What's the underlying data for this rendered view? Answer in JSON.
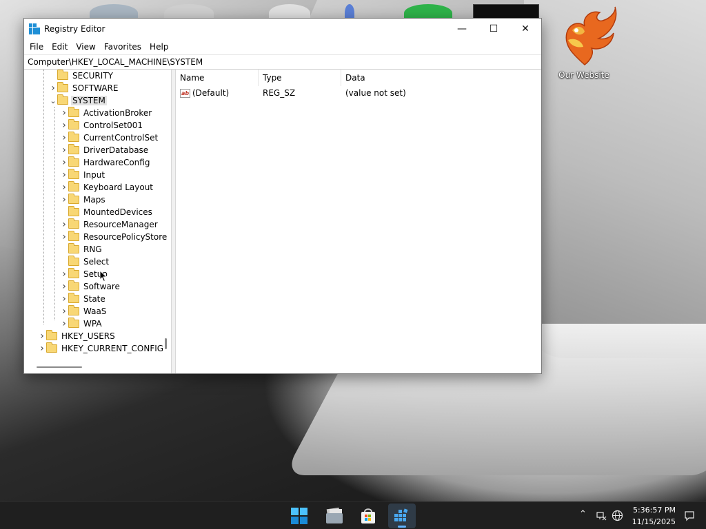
{
  "window": {
    "title": "Registry Editor",
    "minimize_glyph": "—",
    "maximize_glyph": "☐",
    "close_glyph": "✕"
  },
  "menu": [
    "File",
    "Edit",
    "View",
    "Favorites",
    "Help"
  ],
  "address": "Computer\\HKEY_LOCAL_MACHINE\\SYSTEM",
  "tree": [
    {
      "label": "SECURITY",
      "level": 1,
      "expander": "none"
    },
    {
      "label": "SOFTWARE",
      "level": 1,
      "expander": "collapsed"
    },
    {
      "label": "SYSTEM",
      "level": 1,
      "expander": "expanded",
      "selected": true
    },
    {
      "label": "ActivationBroker",
      "level": 2,
      "expander": "collapsed"
    },
    {
      "label": "ControlSet001",
      "level": 2,
      "expander": "collapsed"
    },
    {
      "label": "CurrentControlSet",
      "level": 2,
      "expander": "collapsed"
    },
    {
      "label": "DriverDatabase",
      "level": 2,
      "expander": "collapsed"
    },
    {
      "label": "HardwareConfig",
      "level": 2,
      "expander": "collapsed"
    },
    {
      "label": "Input",
      "level": 2,
      "expander": "collapsed"
    },
    {
      "label": "Keyboard Layout",
      "level": 2,
      "expander": "collapsed"
    },
    {
      "label": "Maps",
      "level": 2,
      "expander": "collapsed"
    },
    {
      "label": "MountedDevices",
      "level": 2,
      "expander": "none"
    },
    {
      "label": "ResourceManager",
      "level": 2,
      "expander": "collapsed"
    },
    {
      "label": "ResourcePolicyStore",
      "level": 2,
      "expander": "collapsed"
    },
    {
      "label": "RNG",
      "level": 2,
      "expander": "none"
    },
    {
      "label": "Select",
      "level": 2,
      "expander": "none"
    },
    {
      "label": "Setup",
      "level": 2,
      "expander": "collapsed"
    },
    {
      "label": "Software",
      "level": 2,
      "expander": "collapsed"
    },
    {
      "label": "State",
      "level": 2,
      "expander": "collapsed"
    },
    {
      "label": "WaaS",
      "level": 2,
      "expander": "collapsed"
    },
    {
      "label": "WPA",
      "level": 2,
      "expander": "collapsed"
    },
    {
      "label": "HKEY_USERS",
      "level": 0,
      "expander": "collapsed"
    },
    {
      "label": "HKEY_CURRENT_CONFIG",
      "level": 0,
      "expander": "collapsed"
    }
  ],
  "list": {
    "columns": [
      "Name",
      "Type",
      "Data"
    ],
    "rows": [
      {
        "name": "(Default)",
        "type": "REG_SZ",
        "data": "(value not set)",
        "icon": "string-value-icon"
      }
    ]
  },
  "desktop": {
    "shortcut_label": "Our Website"
  },
  "taskbar": {
    "time": "5:36:57 PM",
    "date": "11/15/2025",
    "apps": [
      "start-icon",
      "file-explorer-icon",
      "microsoft-store-icon",
      "registry-editor-icon"
    ],
    "active_app": "registry-editor-icon"
  },
  "colors": {
    "folder": "#f8d775",
    "accent": "#1e8fd6",
    "taskbar": "#1f1f1f"
  }
}
